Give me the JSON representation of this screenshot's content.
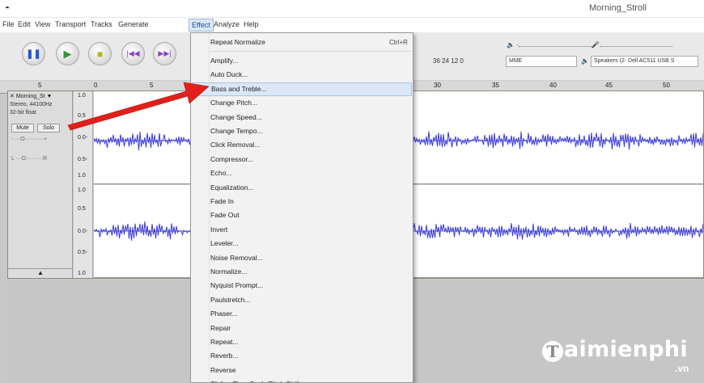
{
  "window": {
    "title": "Morning_Stroll"
  },
  "menubar": {
    "items": [
      "File",
      "Edit",
      "View",
      "Transport",
      "Tracks",
      "Generate",
      "Effect",
      "Analyze",
      "Help"
    ],
    "active": "Effect"
  },
  "toolbar": {
    "buttons": [
      "pause",
      "play",
      "stop",
      "skip-to-start",
      "skip-to-end"
    ],
    "meter_ticks": "36   24   12   0",
    "host": "MME",
    "output_device": "Speakers (2- Dell AC511 USB S"
  },
  "ruler": {
    "ticks": [
      "5",
      "0",
      "5",
      "30",
      "35",
      "40",
      "45",
      "50"
    ]
  },
  "track": {
    "name": "Morning_St",
    "format": "Stereo, 44100Hz",
    "bit_depth": "32-bit float",
    "mute_label": "Mute",
    "solo_label": "Solo",
    "gain_left": "-",
    "gain_right": "+",
    "pan_left": "L",
    "pan_right": "R",
    "scale_top": [
      "1.0",
      "0.5",
      "0.0-",
      "0.5-",
      "1.0"
    ],
    "scale_bottom": [
      "1.0",
      "0.5",
      "0.0-",
      "0.5-",
      "1.0"
    ]
  },
  "effect_menu": {
    "repeat": {
      "label": "Repeat Normalize",
      "shortcut": "Ctrl+R"
    },
    "items": [
      "Amplify...",
      "Auto Duck...",
      "Bass and Treble...",
      "Change Pitch...",
      "Change Speed...",
      "Change Tempo...",
      "Click Removal...",
      "Compressor...",
      "Echo...",
      "Equalization...",
      "Fade In",
      "Fade Out",
      "Invert",
      "Leveler...",
      "Noise Removal...",
      "Normalize...",
      "Nyquist Prompt...",
      "Paulstretch...",
      "Phaser...",
      "Repair",
      "Repeat...",
      "Reverb...",
      "Reverse",
      "Sliding Time Scale/Pitch Shift..."
    ],
    "highlighted": "Bass and Treble..."
  },
  "watermark": {
    "brand": "aimienphi",
    "tld": ".vn"
  },
  "colors": {
    "wave": "#3a3ad6",
    "arrow": "#e0211b",
    "menu_highlight": "#dbe7f7"
  }
}
